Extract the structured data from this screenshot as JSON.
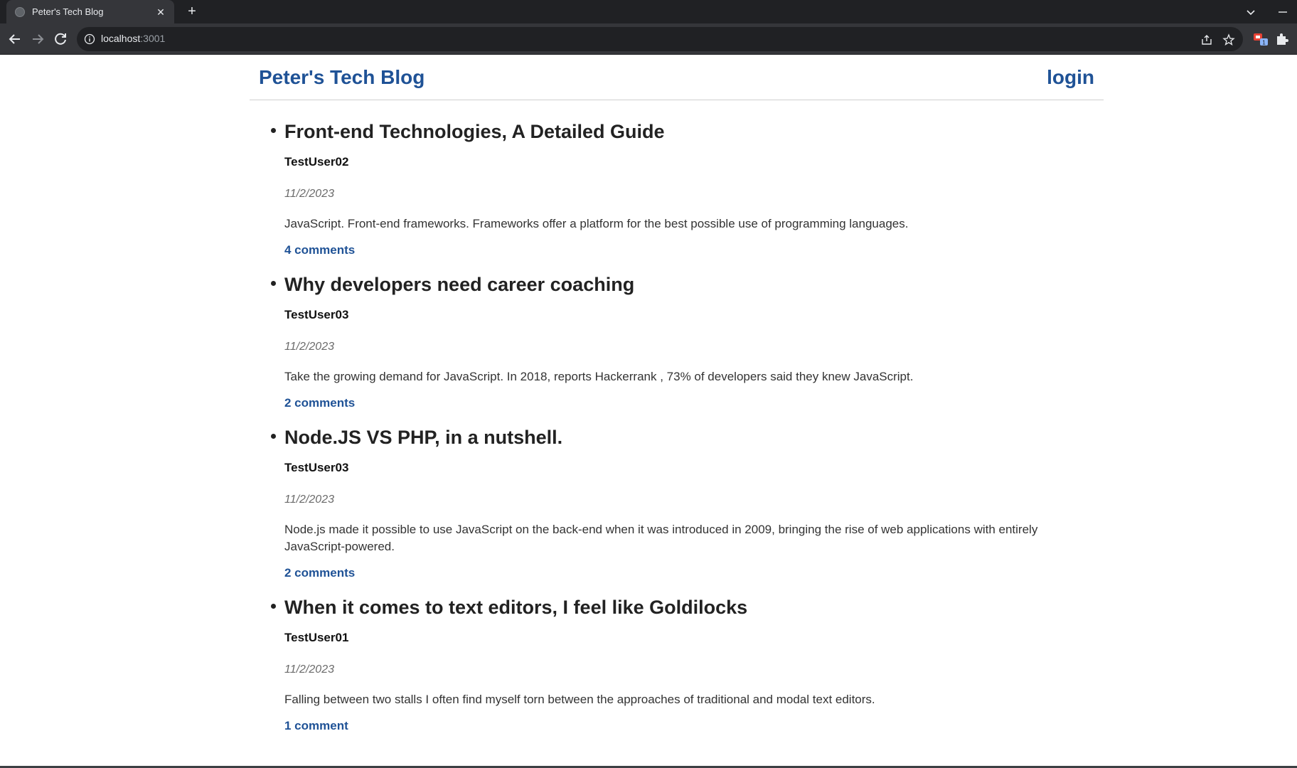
{
  "browser": {
    "tab_title": "Peter's Tech Blog",
    "url_host": "localhost",
    "url_port": ":3001",
    "extension_badge": "1"
  },
  "site": {
    "title": "Peter's Tech Blog",
    "login_label": "login"
  },
  "posts": [
    {
      "title": "Front-end Technologies, A Detailed Guide",
      "author": "TestUser02",
      "date": "11/2/2023",
      "body": "JavaScript. Front-end frameworks. Frameworks offer a platform for the best possible use of programming languages.",
      "comments": "4 comments"
    },
    {
      "title": "Why developers need career coaching",
      "author": "TestUser03",
      "date": "11/2/2023",
      "body": "Take the growing demand for JavaScript. In 2018, reports Hackerrank , 73% of developers said they knew JavaScript.",
      "comments": "2 comments"
    },
    {
      "title": "Node.JS VS PHP, in a nutshell.",
      "author": "TestUser03",
      "date": "11/2/2023",
      "body": "Node.js made it possible to use JavaScript on the back-end when it was introduced in 2009, bringing the rise of web applications with entirely JavaScript-powered.",
      "comments": "2 comments"
    },
    {
      "title": "When it comes to text editors, I feel like Goldilocks",
      "author": "TestUser01",
      "date": "11/2/2023",
      "body": "Falling between two stalls I often find myself torn between the approaches of traditional and modal text editors.",
      "comments": "1 comment"
    }
  ],
  "colors": {
    "link": "#1f5296",
    "chrome_dark": "#202124",
    "chrome_toolbar": "#35363a"
  }
}
